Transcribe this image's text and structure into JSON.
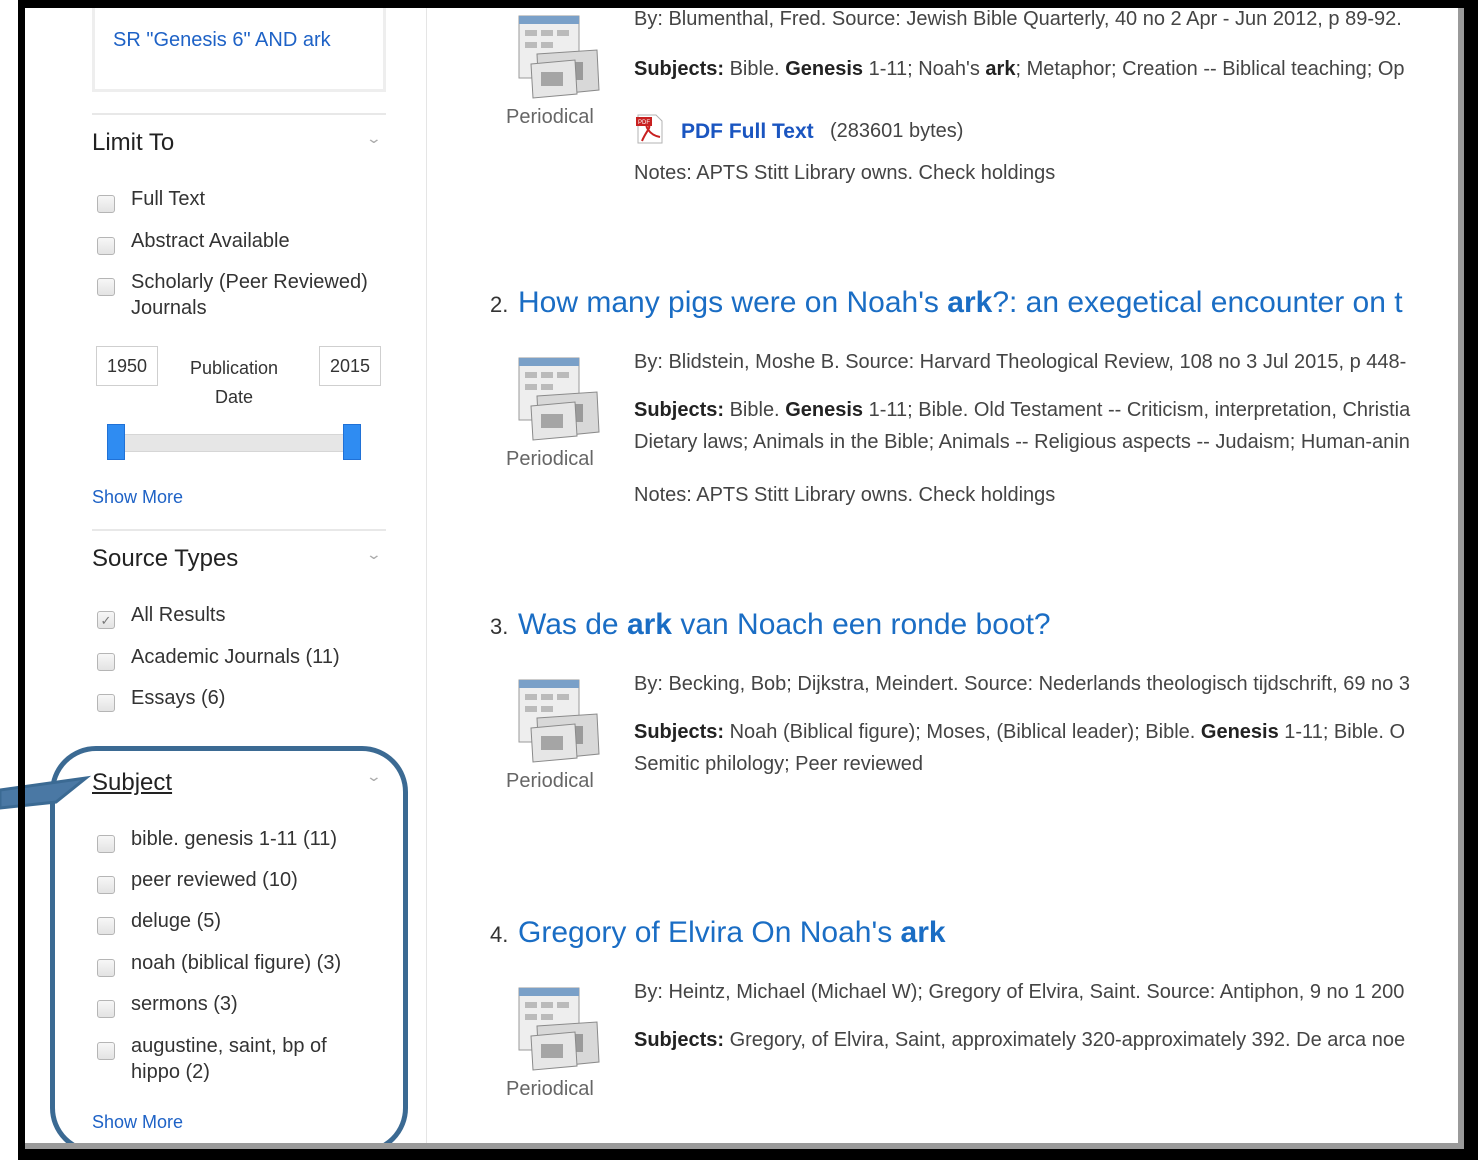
{
  "search": {
    "query": "SR \"Genesis 6\" AND ark"
  },
  "limit_to": {
    "title": "Limit To",
    "options": [
      "Full Text",
      "Abstract Available",
      "Scholarly (Peer Reviewed)",
      "Journals"
    ],
    "date_from": "1950",
    "date_to": "2015",
    "date_label_1": "Publication",
    "date_label_2": "Date",
    "show_more": "Show More"
  },
  "source_types": {
    "title": "Source Types",
    "options": [
      "All Results",
      "Academic Journals (11)",
      "Essays (6)"
    ]
  },
  "subject": {
    "title": "Subject",
    "options": [
      "bible. genesis 1-11 (11)",
      "peer reviewed (10)",
      "deluge (5)",
      "noah (biblical figure) (3)",
      "sermons (3)",
      "augustine, saint, bp of",
      "hippo (2)"
    ],
    "show_more": "Show More"
  },
  "results": [
    {
      "type": "Periodical",
      "by": "By: Blumenthal, Fred. Source: Jewish Bible Quarterly, 40 no 2 Apr - Jun 2012, p 89-92.",
      "subjects_label": "Subjects:",
      "subjects": [
        " Bible. ",
        "Genesis",
        " 1-11; Noah's ",
        "ark",
        "; Metaphor; Creation -- Biblical teaching; Op"
      ],
      "pdf_label": "PDF Full Text",
      "pdf_size": "(283601 bytes)",
      "notes": "Notes:  APTS Stitt Library owns. Check holdings"
    },
    {
      "num": "2.",
      "title": [
        "How many pigs were on Noah's ",
        "ark",
        "?: an exegetical encounter on t"
      ],
      "type": "Periodical",
      "by": "By: Blidstein, Moshe B. Source: Harvard Theological Review, 108 no 3 Jul 2015, p 448-",
      "subjects_label": "Subjects:",
      "subjects": [
        " Bible. ",
        "Genesis",
        " 1-11; Bible. Old Testament -- Criticism, interpretation, Christia"
      ],
      "subjects_line2": "Dietary laws; Animals in the Bible; Animals -- Religious aspects -- Judaism; Human-anin",
      "notes": "Notes:  APTS Stitt Library owns. Check holdings"
    },
    {
      "num": "3.",
      "title": [
        "Was de ",
        "ark",
        " van Noach een ronde boot?"
      ],
      "type": "Periodical",
      "by": "By: Becking, Bob; Dijkstra, Meindert. Source: Nederlands theologisch tijdschrift, 69 no 3",
      "subjects_label": "Subjects:",
      "subjects": [
        " Noah (Biblical figure); Moses, (Biblical leader); Bible. ",
        "Genesis",
        " 1-11; Bible. O"
      ],
      "subjects_line2": "Semitic philology; Peer reviewed"
    },
    {
      "num": "4.",
      "title": [
        "Gregory of Elvira On Noah's ",
        "ark"
      ],
      "type": "Periodical",
      "by": "By: Heintz, Michael (Michael W); Gregory of Elvira, Saint. Source: Antiphon, 9 no 1 200",
      "subjects_label": "Subjects:",
      "subjects": [
        " Gregory, of Elvira, Saint, approximately 320-approximately 392. De arca noe"
      ]
    }
  ],
  "icons": {
    "periodical": "periodical-icon",
    "pdf": "pdf-icon",
    "chevron": "chevron-down-icon",
    "check": "checkmark-icon"
  },
  "colors": {
    "link": "#1a6dc4",
    "callout": "#3b6a93",
    "slider": "#2f8cf2"
  }
}
